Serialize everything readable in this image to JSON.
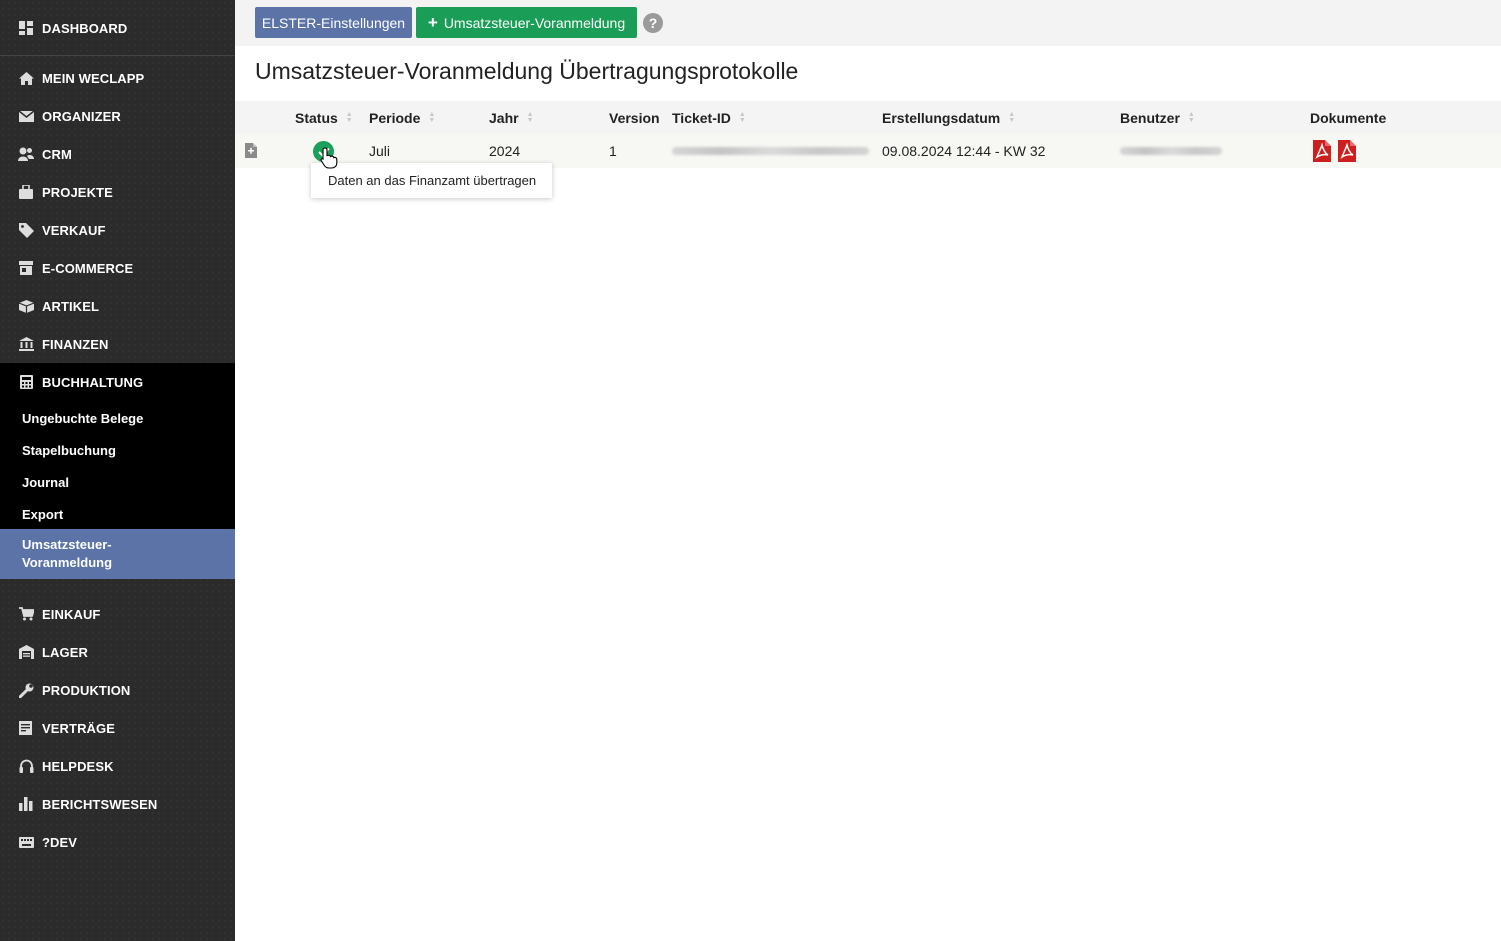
{
  "sidebar": {
    "top_items": [
      {
        "label": "DASHBOARD",
        "icon": "dashboard-icon"
      },
      {
        "label": "MEIN WECLAPP",
        "icon": "home-icon"
      },
      {
        "label": "ORGANIZER",
        "icon": "envelope-icon"
      },
      {
        "label": "CRM",
        "icon": "users-icon"
      },
      {
        "label": "PROJEKTE",
        "icon": "briefcase-icon"
      },
      {
        "label": "VERKAUF",
        "icon": "tag-icon"
      },
      {
        "label": "E-COMMERCE",
        "icon": "store-icon"
      },
      {
        "label": "ARTIKEL",
        "icon": "box-icon"
      },
      {
        "label": "FINANZEN",
        "icon": "bank-icon"
      },
      {
        "label": "BUCHHALTUNG",
        "icon": "calculator-icon"
      }
    ],
    "buchhaltung_sub": [
      {
        "label": "Ungebuchte Belege"
      },
      {
        "label": "Stapelbuchung"
      },
      {
        "label": "Journal"
      },
      {
        "label": "Export"
      },
      {
        "label_line1": "Umsatzsteuer-",
        "label_line2": "Voranmeldung",
        "active": true
      }
    ],
    "bottom_items": [
      {
        "label": "EINKAUF",
        "icon": "cart-icon"
      },
      {
        "label": "LAGER",
        "icon": "warehouse-icon"
      },
      {
        "label": "PRODUKTION",
        "icon": "wrench-icon"
      },
      {
        "label": "VERTRÄGE",
        "icon": "contract-icon"
      },
      {
        "label": "HELPDESK",
        "icon": "headset-icon"
      },
      {
        "label": "BERICHTSWESEN",
        "icon": "bar-chart-icon"
      },
      {
        "label": "?DEV",
        "icon": "keyboard-icon"
      }
    ]
  },
  "toolbar": {
    "elster_label": "ELSTER-Einstellungen",
    "ust_label": "Umsatzsteuer-Voranmeldung",
    "help_label": "?"
  },
  "page": {
    "title": "Umsatzsteuer-Voranmeldung Übertragungsprotokolle"
  },
  "table": {
    "headers": {
      "status": "Status",
      "periode": "Periode",
      "jahr": "Jahr",
      "version": "Version",
      "ticket": "Ticket-ID",
      "datum": "Erstellungsdatum",
      "benutzer": "Benutzer",
      "dokumente": "Dokumente"
    },
    "rows": [
      {
        "periode": "Juli",
        "jahr": "2024",
        "version": "1",
        "datum": "09.08.2024 12:44 - KW 32"
      }
    ]
  },
  "tooltip": {
    "text": "Daten an das Finanzamt übertragen"
  },
  "colors": {
    "sidebar": "#2b2b2b",
    "active": "#5b73a6",
    "green": "#1a9e57",
    "pdf_red": "#cc1f1f"
  }
}
